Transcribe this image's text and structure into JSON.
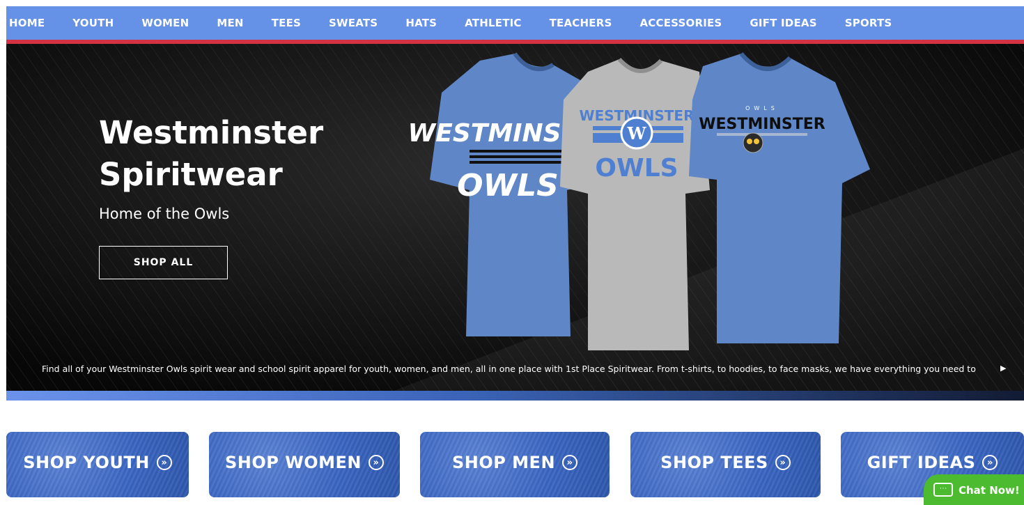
{
  "nav": {
    "items": [
      {
        "label": "HOME"
      },
      {
        "label": "YOUTH"
      },
      {
        "label": "WOMEN"
      },
      {
        "label": "MEN"
      },
      {
        "label": "TEES"
      },
      {
        "label": "SWEATS"
      },
      {
        "label": "HATS"
      },
      {
        "label": "ATHLETIC"
      },
      {
        "label": "TEACHERS"
      },
      {
        "label": "ACCESSORIES"
      },
      {
        "label": "GIFT IDEAS"
      },
      {
        "label": "SPORTS"
      }
    ]
  },
  "hero": {
    "title_line1": "Westminster",
    "title_line2": "Spiritwear",
    "subtitle": "Home of the Owls",
    "button_label": "SHOP ALL",
    "description": "Find all of your Westminster Owls spirit wear and school spirit apparel for youth, women, and men, all in one place with 1st Place Spiritwear. From t-shirts, to hoodies, to face masks, we have everything you need to",
    "arrow_icon": "play-right-icon",
    "shirts": [
      {
        "color": "#6088c8",
        "text_top": "WESTMINSTER",
        "text_bottom": "OWLS"
      },
      {
        "color": "#b8b8b8",
        "text_top": "WESTMINSTER",
        "emblem": "W",
        "text_bottom": "OWLS"
      },
      {
        "color": "#6088c8",
        "text_small": "OWLS",
        "text_top": "WESTMINSTER"
      }
    ]
  },
  "tiles": [
    {
      "label": "SHOP YOUTH",
      "icon": "double-chevron-right-icon"
    },
    {
      "label": "SHOP WOMEN",
      "icon": "double-chevron-right-icon"
    },
    {
      "label": "SHOP MEN",
      "icon": "double-chevron-right-icon"
    },
    {
      "label": "SHOP TEES",
      "icon": "double-chevron-right-icon"
    },
    {
      "label": "GIFT IDEAS",
      "icon": "double-chevron-right-icon"
    }
  ],
  "chat": {
    "label": "Chat Now!",
    "icon": "chat-bubble-icon"
  },
  "colors": {
    "nav_bg": "#6591e6",
    "nav_stripe": "#d23243",
    "hero_bg": "#0c0c0c",
    "tile_bg": "#3f6cc8",
    "chat_bg": "#4dbb2f"
  }
}
